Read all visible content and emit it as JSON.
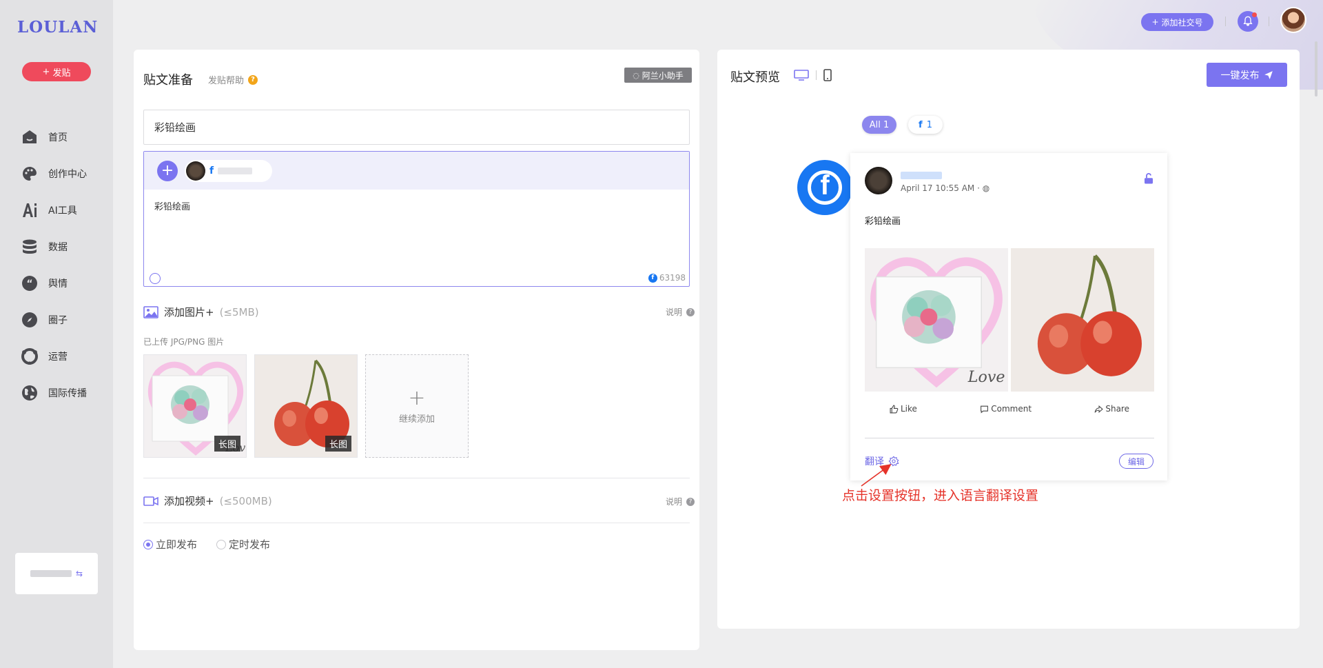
{
  "sidebar": {
    "logo": "LOULAN",
    "post_button": "发贴",
    "items": [
      {
        "label": "首页",
        "icon": "home-icon"
      },
      {
        "label": "创作中心",
        "icon": "palette-icon"
      },
      {
        "label": "AI工具",
        "icon": "ai-icon"
      },
      {
        "label": "数据",
        "icon": "database-icon"
      },
      {
        "label": "舆情",
        "icon": "quote-icon"
      },
      {
        "label": "圈子",
        "icon": "compass-icon"
      },
      {
        "label": "运营",
        "icon": "operations-icon"
      },
      {
        "label": "国际传播",
        "icon": "globe-icon"
      }
    ]
  },
  "topbar": {
    "add_social": "添加社交号"
  },
  "composer": {
    "title": "贴文准备",
    "help": "发贴帮助",
    "assistant": "阿兰小助手",
    "title_value": "彩铅绘画",
    "account_fb_letter": "f",
    "body_text": "彩铅绘画",
    "char_count": "63198",
    "images": {
      "label": "添加图片+",
      "limit": "(≤5MB)",
      "explain": "说明",
      "uploaded_label": "已上传 JPG/PNG 图片",
      "tag": "长图",
      "add_more": "继续添加"
    },
    "video": {
      "label": "添加视频+",
      "limit": "(≤500MB)",
      "explain": "说明"
    },
    "publish_options": {
      "now": "立即发布",
      "scheduled": "定时发布",
      "selected": "立即发布"
    }
  },
  "preview": {
    "title": "贴文预览",
    "publish_button": "一键发布",
    "filter_all": "All 1",
    "filter_fb": "1",
    "post": {
      "time": "April 17 10:55 AM ·",
      "text": "彩铅绘画",
      "like": "Like",
      "comment": "Comment",
      "share": "Share",
      "translate": "翻译",
      "edit": "编辑"
    },
    "annotation": "点击设置按钮，进入语言翻译设置"
  },
  "colors": {
    "accent": "#7b74f0",
    "post_button": "#ef4a5c",
    "facebook": "#1877f2",
    "annotation": "#e5332a"
  }
}
